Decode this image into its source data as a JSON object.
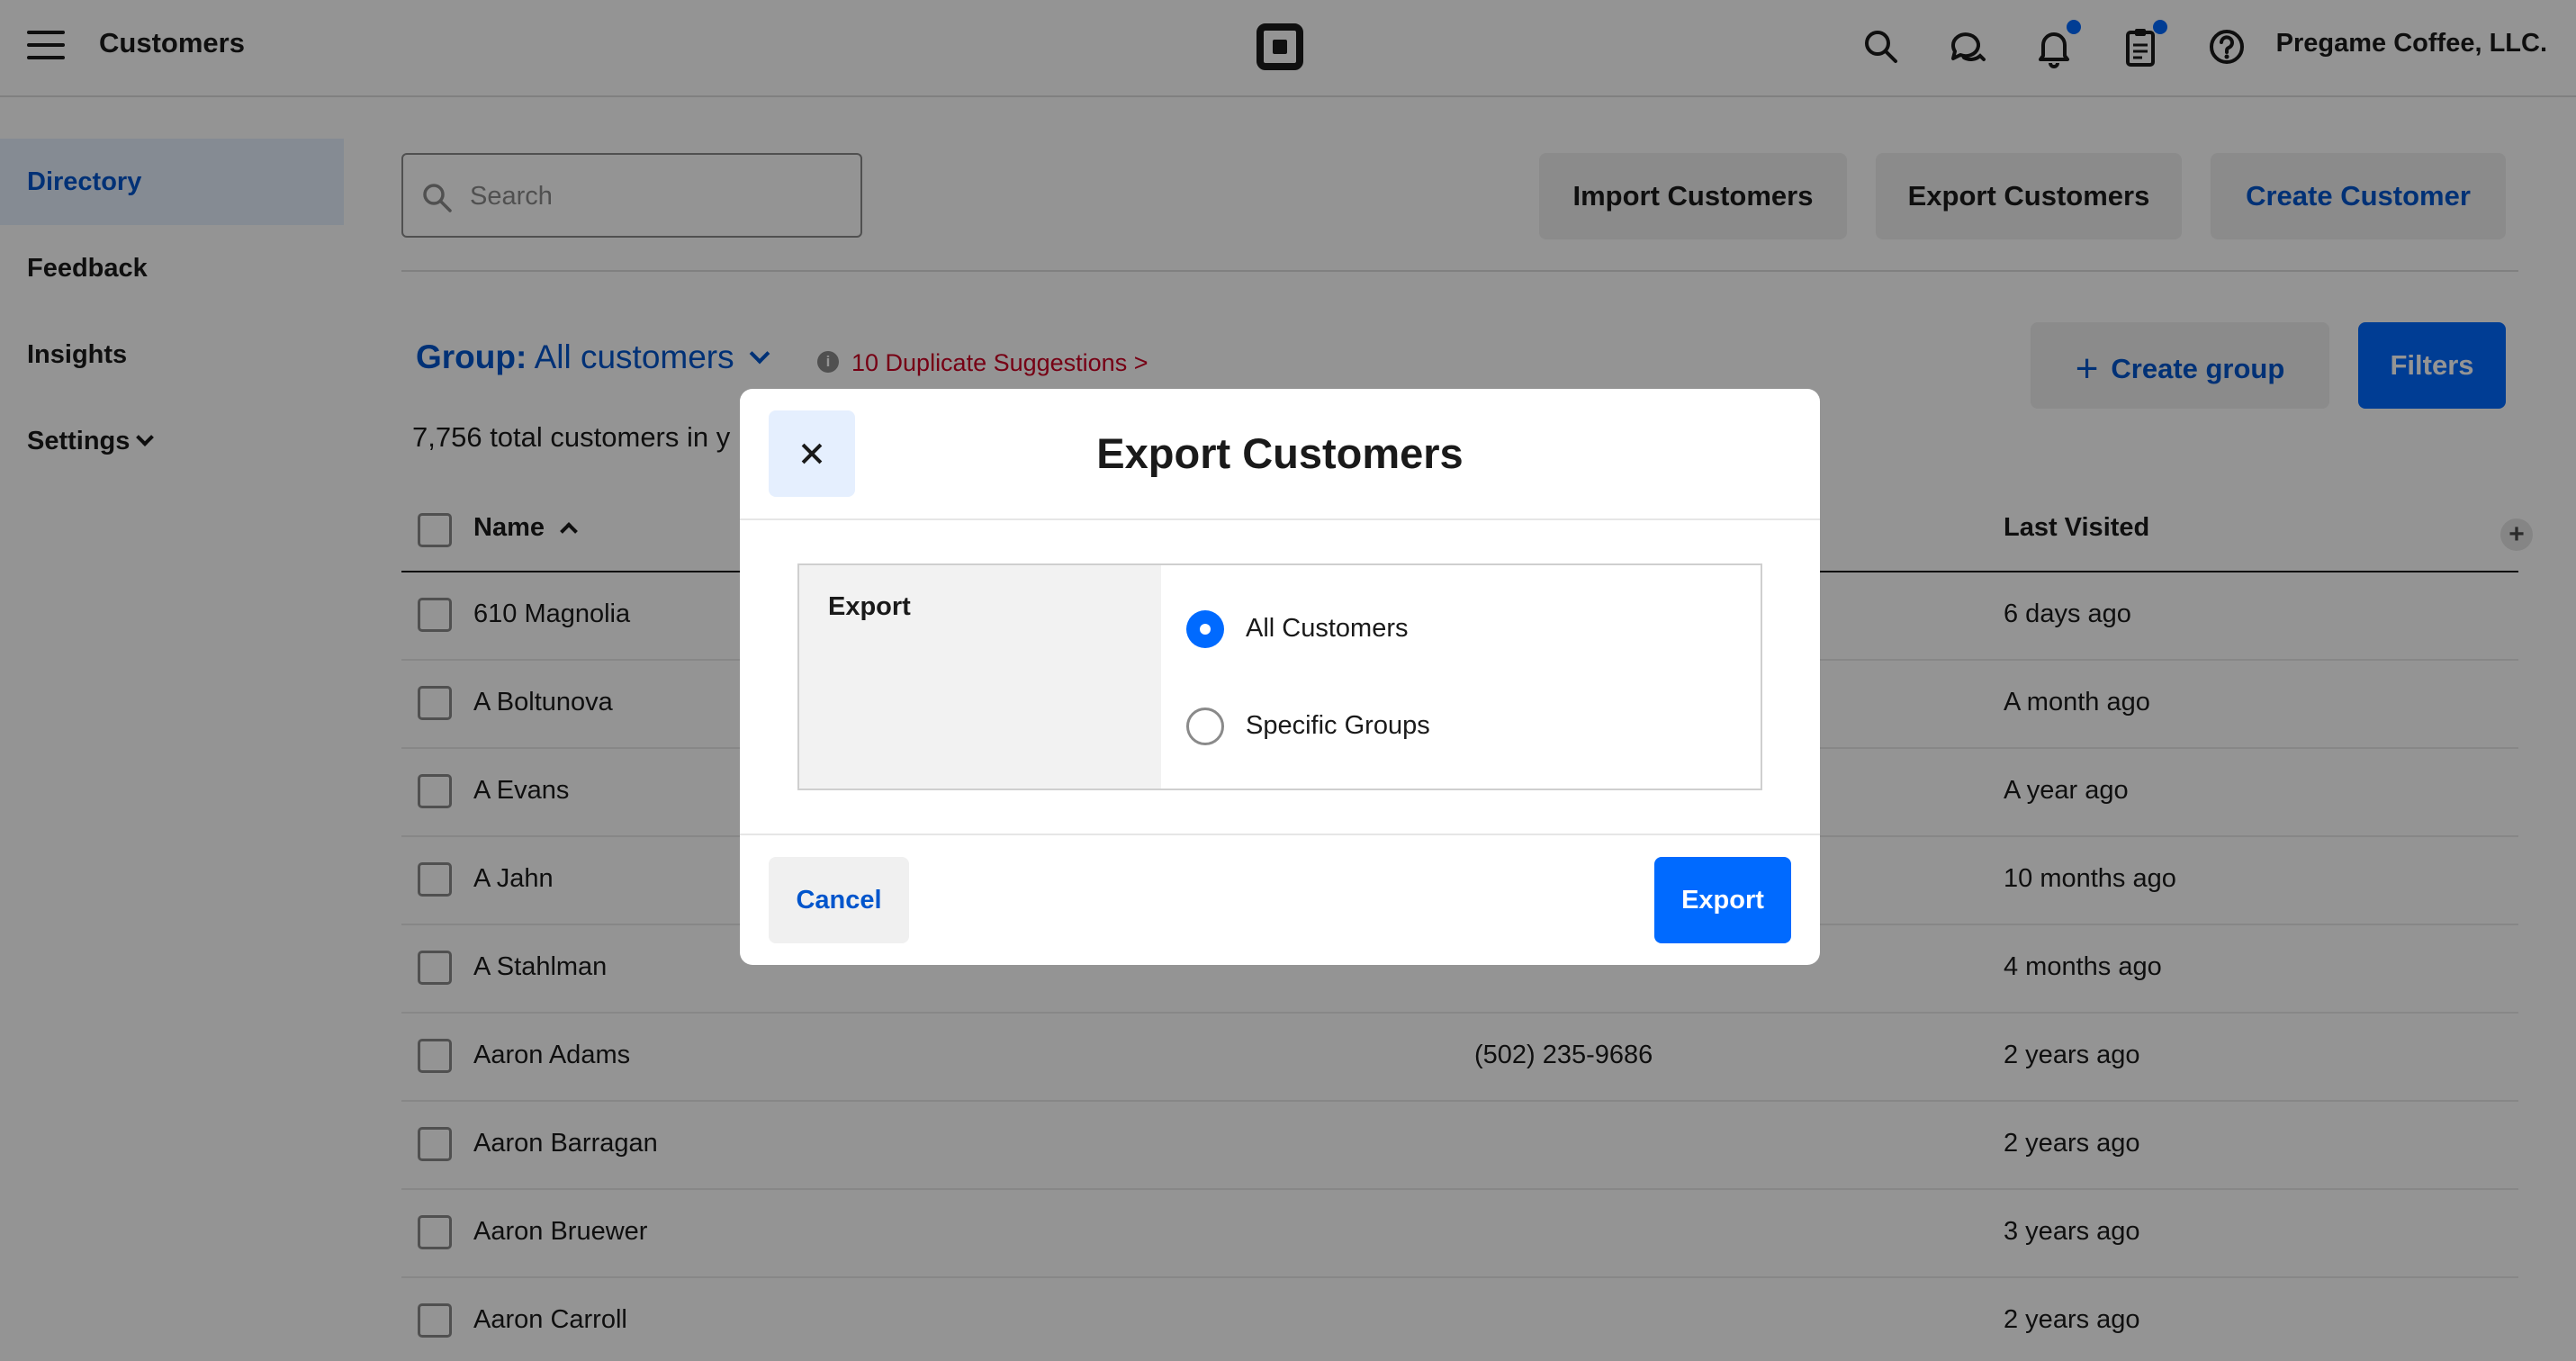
{
  "header": {
    "title": "Customers",
    "account_name": "Pregame Coffee, LLC.",
    "icons": [
      "menu-icon",
      "square-logo-icon",
      "search-icon",
      "messages-icon",
      "bell-icon",
      "clipboard-icon",
      "help-icon"
    ]
  },
  "sidebar": {
    "items": [
      {
        "label": "Directory",
        "active": true
      },
      {
        "label": "Feedback",
        "active": false
      },
      {
        "label": "Insights",
        "active": false
      },
      {
        "label": "Settings",
        "active": false
      }
    ]
  },
  "toolbar": {
    "search_placeholder": "Search",
    "import_label": "Import Customers",
    "export_label": "Export Customers",
    "create_label": "Create Customer"
  },
  "group": {
    "prefix": "Group:",
    "name": "All customers",
    "duplicates": "10 Duplicate Suggestions >",
    "total": "7,756 total customers in y",
    "create_group_label": "Create group",
    "filters_label": "Filters"
  },
  "table": {
    "columns": {
      "name": "Name",
      "last_visited": "Last Visited"
    },
    "rows": [
      {
        "name": "610 Magnolia",
        "phone": "",
        "last_visited": "6 days ago"
      },
      {
        "name": "A Boltunova",
        "phone": "",
        "last_visited": "A month ago"
      },
      {
        "name": "A Evans",
        "phone": "",
        "last_visited": "A year ago"
      },
      {
        "name": "A Jahn",
        "phone": "",
        "last_visited": "10 months ago"
      },
      {
        "name": "A Stahlman",
        "phone": "",
        "last_visited": "4 months ago"
      },
      {
        "name": "Aaron Adams",
        "phone": "(502) 235-9686",
        "last_visited": "2 years ago"
      },
      {
        "name": "Aaron Barragan",
        "phone": "",
        "last_visited": "2 years ago"
      },
      {
        "name": "Aaron Bruewer",
        "phone": "",
        "last_visited": "3 years ago"
      },
      {
        "name": "Aaron Carroll",
        "phone": "",
        "last_visited": "2 years ago"
      }
    ]
  },
  "modal": {
    "title": "Export Customers",
    "field_label": "Export",
    "options": [
      {
        "label": "All Customers",
        "selected": true
      },
      {
        "label": "Specific Groups",
        "selected": false
      }
    ],
    "cancel_label": "Cancel",
    "export_label": "Export"
  },
  "colors": {
    "accent": "#006aff",
    "link": "#0055cc",
    "danger": "#cc0023",
    "overlay": "rgba(0,0,0,0.42)"
  }
}
